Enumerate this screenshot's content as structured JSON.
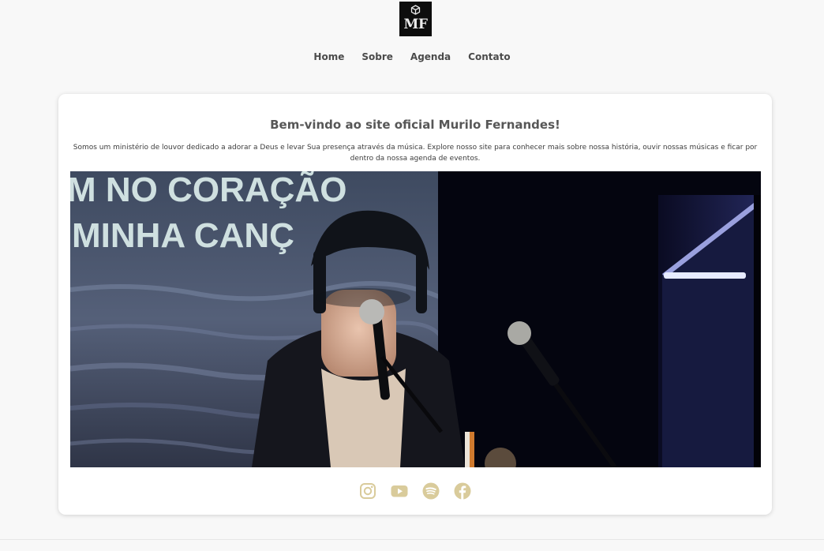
{
  "brand": {
    "logo_text": "MF"
  },
  "nav": {
    "items": [
      {
        "label": "Home"
      },
      {
        "label": "Sobre"
      },
      {
        "label": "Agenda"
      },
      {
        "label": "Contato"
      }
    ]
  },
  "main": {
    "title": "Bem-vindo ao site oficial Murilo Fernandes!",
    "description": "Somos um ministério de louvor dedicado a adorar a Deus e levar Sua presença através da música. Explore nosso site para conhecer mais sobre nossa história, ouvir nossas músicas e ficar por dentro da nossa agenda de eventos.",
    "hero": {
      "screen_text_line1": "M NO CORAÇÃO",
      "screen_text_line2": "MINHA CANÇ"
    }
  },
  "social": {
    "color": "#d9cb9b",
    "icons": [
      "instagram-icon",
      "youtube-icon",
      "spotify-icon",
      "facebook-icon"
    ]
  }
}
